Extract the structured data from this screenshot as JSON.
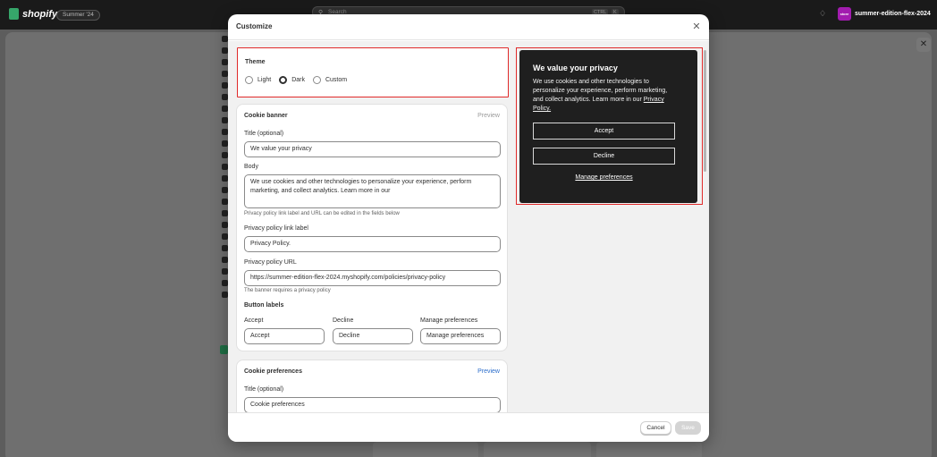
{
  "topbar": {
    "brand": "shopify",
    "edition_badge": "Summer '24",
    "search_placeholder": "Search",
    "search_shortcut_1": "CTRL",
    "search_shortcut_2": "K",
    "store_avatar": "store",
    "store_name": "summer-edition-flex-2024"
  },
  "modal": {
    "title": "Customize",
    "theme": {
      "title": "Theme",
      "options": [
        "Light",
        "Dark",
        "Custom"
      ],
      "selected": "Dark"
    },
    "cookie_banner": {
      "title": "Cookie banner",
      "preview_label": "Preview",
      "title_label": "Title (optional)",
      "title_value": "We value your privacy",
      "body_label": "Body",
      "body_value": "We use cookies and other technologies to personalize your experience, perform marketing, and collect analytics. Learn more in our",
      "body_help": "Privacy policy link label and URL can be edited in the fields below",
      "link_label_label": "Privacy policy link label",
      "link_label_value": "Privacy Policy.",
      "url_label": "Privacy policy URL",
      "url_value": "https://summer-edition-flex-2024.myshopify.com/policies/privacy-policy",
      "url_help": "The banner requires a privacy policy",
      "button_labels_title": "Button labels",
      "accept_label": "Accept",
      "accept_value": "Accept",
      "decline_label": "Decline",
      "decline_value": "Decline",
      "manage_label": "Manage preferences",
      "manage_value": "Manage preferences"
    },
    "cookie_preferences": {
      "title": "Cookie preferences",
      "preview_label": "Preview",
      "title_label": "Title (optional)",
      "title_value": "Cookie preferences"
    },
    "preview": {
      "title": "We value your privacy",
      "body": "We use cookies and other technologies to personalize your experience, perform marketing, and collect analytics. Learn more in our",
      "link": "Privacy Policy.",
      "accept": "Accept",
      "decline": "Decline",
      "manage": "Manage preferences"
    },
    "footer": {
      "cancel": "Cancel",
      "save": "Save"
    }
  },
  "colors": {
    "highlight_outline": "#e02a2a",
    "preview_background": "#1f1f1f",
    "link_blue": "#2c6ecb"
  }
}
